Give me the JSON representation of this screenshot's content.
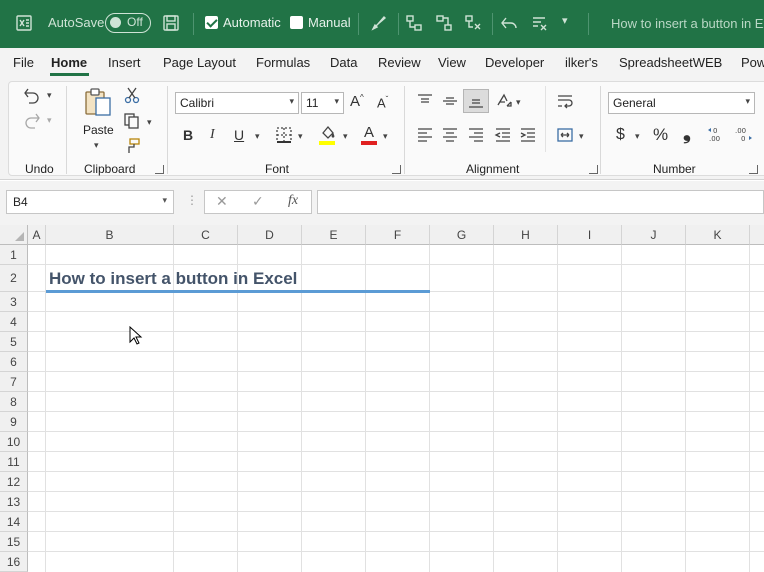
{
  "titlebar": {
    "autosave_label": "AutoSave",
    "autosave_state": "Off",
    "automatic_label": "Automatic",
    "manual_label": "Manual",
    "doc_title": "How to insert a button in Excel",
    "bg_color": "#217346"
  },
  "tabs": [
    {
      "label": "File"
    },
    {
      "label": "Home",
      "active": true
    },
    {
      "label": "Insert"
    },
    {
      "label": "Page Layout"
    },
    {
      "label": "Formulas"
    },
    {
      "label": "Data"
    },
    {
      "label": "Review"
    },
    {
      "label": "View"
    },
    {
      "label": "Developer"
    },
    {
      "label": "ilker's"
    },
    {
      "label": "SpreadsheetWEB"
    },
    {
      "label": "Pow"
    }
  ],
  "ribbon": {
    "groups": {
      "undo": "Undo",
      "clipboard": "Clipboard",
      "font": "Font",
      "alignment": "Alignment",
      "number": "Number"
    },
    "paste_label": "Paste",
    "font_name": "Calibri",
    "font_size": "11",
    "bold": "B",
    "italic": "I",
    "underline": "U",
    "number_format": "General",
    "currency": "$",
    "percent": "%",
    "comma": "❟",
    "grow_font": "A",
    "shrink_font": "A",
    "font_color_letter": "A"
  },
  "formula_bar": {
    "name_box": "B4",
    "fx": "fx",
    "formula": ""
  },
  "grid": {
    "columns": [
      "A",
      "B",
      "C",
      "D",
      "E",
      "F",
      "G",
      "H",
      "I",
      "J",
      "K"
    ],
    "rows": [
      "1",
      "2",
      "3",
      "4",
      "5",
      "6",
      "7",
      "8",
      "9",
      "10",
      "11",
      "12",
      "13",
      "14",
      "15",
      "16"
    ],
    "cells": {
      "B2": "How to insert a button in Excel"
    },
    "title_color": "#44546a",
    "underline_color": "#5b9bd5"
  }
}
